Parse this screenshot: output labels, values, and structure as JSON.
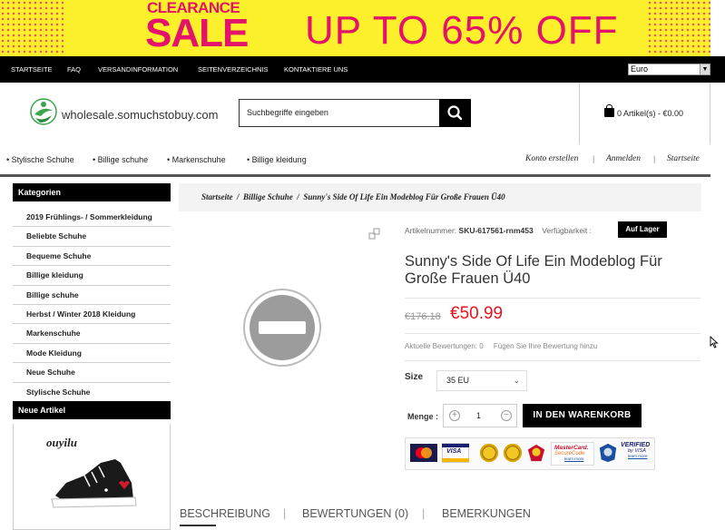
{
  "banner": {
    "clearance": "CLEARANCE",
    "sale": "SALE",
    "offer": "UP TO 65% OFF"
  },
  "topnav": {
    "items": [
      "STARTSEITE",
      "FAQ",
      "VERSANDINFORMATION",
      "SEITENVERZEICHNIS",
      "KONTAKTIERE UNS"
    ],
    "currency": "Euro"
  },
  "header": {
    "logo_text": "wholesale.somuchstobuy.com",
    "search_placeholder": "Suchbegriffe eingeben",
    "cart_text": "0 Artikel(s) - €0.00"
  },
  "catnav": {
    "items": [
      "Stylische Schuhe",
      "Billige schuhe",
      "Markenschuhe",
      "Billige kleidung"
    ],
    "account": [
      "Konto erstellen",
      "Anmelden",
      "Startseite"
    ]
  },
  "sidebar": {
    "categories_title": "Kategorien",
    "categories": [
      "2019 Frühlings- / Sommerkleidung",
      "Beliebte Schuhe",
      "Bequeme Schuhe",
      "Billige kleidung",
      "Billige schuhe",
      "Herbst / Winter 2018 Kleidung",
      "Markenschuhe",
      "Mode Kleidung",
      "Neue Schuhe",
      "Stylische Schuhe"
    ],
    "new_title": "Neue Artikel",
    "new_item_name": "ouyilu"
  },
  "breadcrumb": {
    "home": "Startseite",
    "category": "Billige Schuhe",
    "current": "Sunny's Side Of Life Ein Modeblog Für Große Frauen Ü40",
    "separator": "/"
  },
  "product": {
    "sku_label": "Artikelnummer:",
    "sku": "SKU-617561-rnm453",
    "availability_label": "Verfügbarkeit :",
    "stock": "Auf Lager",
    "title": "Sunny's Side Of Life Ein Modeblog Für Große Frauen Ü40",
    "old_price": "€176.18",
    "price": "€50.99",
    "reviews_label": "Aktuelle Bewertungen: 0",
    "add_review": "Fügen Sie Ihre Bewertung hinzu",
    "size_label": "Size",
    "size_value": "35 EU",
    "qty_label": "Menge :",
    "qty_value": "1",
    "add_to_cart": "IN DEN WARENKORB"
  },
  "payments": {
    "mastercard_label": "MasterCard.",
    "securecode_label": "SecureCode.",
    "visa_label": "VISA",
    "verified_label": "VERIFIED",
    "verified_sub": "by VISA",
    "learn_more": "learn more"
  },
  "tabs": [
    "BESCHREIBUNG",
    "BEWERTUNGEN (0)",
    "BEMERKUNGEN"
  ],
  "tab_separator": "|",
  "colors": {
    "price_red": "#e8131d",
    "banner_yellow": "#fbf02a",
    "banner_pink": "#e3126a",
    "black": "#000000"
  }
}
